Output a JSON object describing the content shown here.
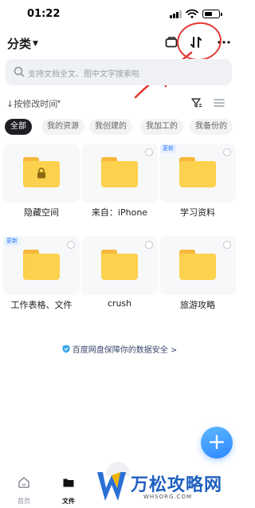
{
  "status_bar": {
    "time": "01:22",
    "battery_level": 0.6
  },
  "header": {
    "title": "分类"
  },
  "search": {
    "placeholder": "支持文档全文、图中文字搜索啦"
  },
  "sort": {
    "label": "↓按修改时间"
  },
  "chips": [
    {
      "label": "全部",
      "active": true
    },
    {
      "label": "我的资源",
      "active": false
    },
    {
      "label": "我创建的",
      "active": false
    },
    {
      "label": "我加工的",
      "active": false
    },
    {
      "label": "我备份的",
      "active": false
    }
  ],
  "folders": [
    {
      "name": "隐藏空间",
      "badge": "",
      "locked": true,
      "selectable": false
    },
    {
      "name": "来自：iPhone",
      "badge": "",
      "locked": false,
      "selectable": true
    },
    {
      "name": "学习资料",
      "badge": "更新",
      "locked": false,
      "selectable": true
    },
    {
      "name": "工作表格、文件",
      "badge": "更新",
      "locked": false,
      "selectable": true
    },
    {
      "name": "crush",
      "badge": "",
      "locked": false,
      "selectable": true
    },
    {
      "name": "旅游攻略",
      "badge": "",
      "locked": false,
      "selectable": true
    }
  ],
  "notice": {
    "text": "百度网盘保障你的数据安全 >"
  },
  "fab": {
    "label": "+"
  },
  "bottom_nav": [
    {
      "label": "首页",
      "icon": "home-icon",
      "active": false
    },
    {
      "label": "文件",
      "icon": "folder-icon",
      "active": true
    }
  ],
  "watermark": {
    "title": "万松攻略网",
    "subtitle": "WHSORG.COM"
  },
  "colors": {
    "accent": "#2d86ff",
    "folder": "#fcd14d",
    "annotation": "#e53935",
    "chip_active": "#1d1f24"
  }
}
